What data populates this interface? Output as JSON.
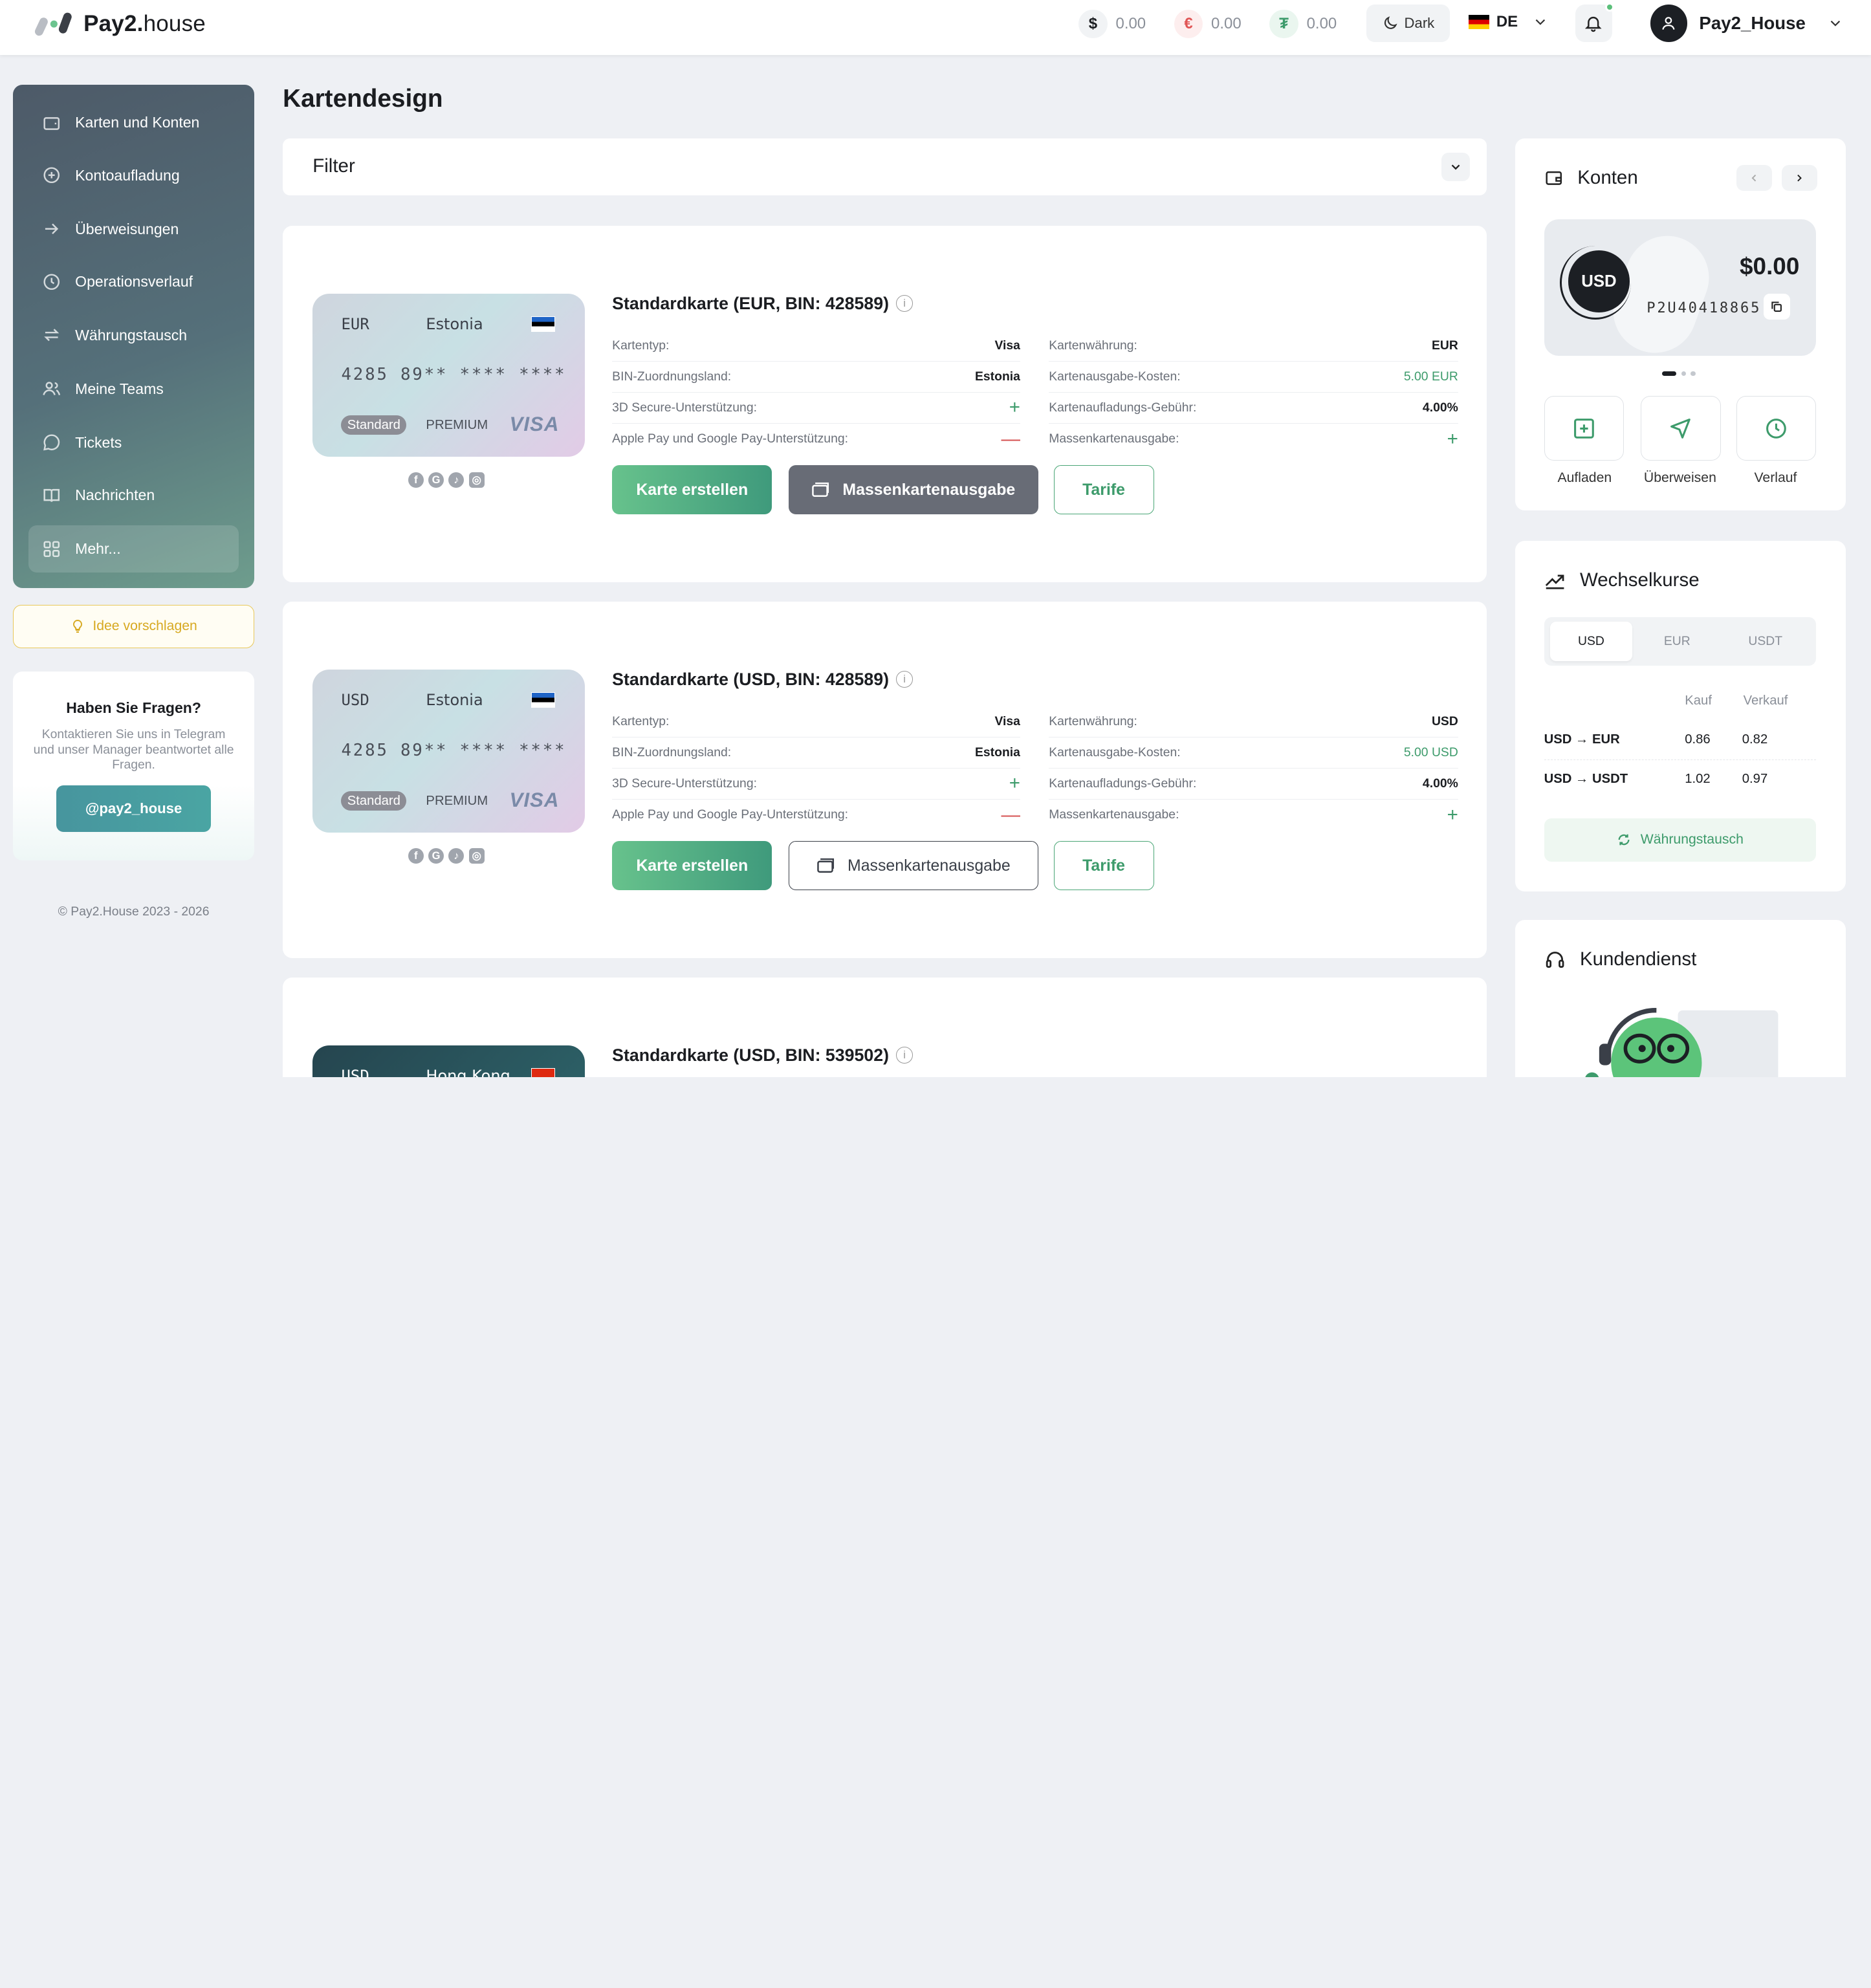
{
  "header": {
    "logo_bold": "Pay2.",
    "logo_light": "house",
    "balances": [
      {
        "symbol": "$",
        "value": "0.00",
        "color": "#1b1d21",
        "bg": "#f1f3f5"
      },
      {
        "symbol": "€",
        "value": "0.00",
        "color": "#e05555",
        "bg": "#fdeeee"
      },
      {
        "symbol": "₮",
        "value": "0.00",
        "color": "#3d9b6b",
        "bg": "#eaf6ef"
      }
    ],
    "theme_label": "Dark",
    "language": "DE",
    "username": "Pay2_House"
  },
  "sidebar": {
    "items": [
      {
        "label": "Karten und Konten",
        "icon": "wallet-icon"
      },
      {
        "label": "Kontoaufladung",
        "icon": "plus-circle-icon"
      },
      {
        "label": "Überweisungen",
        "icon": "arrow-right-icon"
      },
      {
        "label": "Operationsverlauf",
        "icon": "clock-icon"
      },
      {
        "label": "Währungstausch",
        "icon": "exchange-icon"
      },
      {
        "label": "Meine Teams",
        "icon": "team-icon"
      },
      {
        "label": "Tickets",
        "icon": "chat-icon"
      },
      {
        "label": "Nachrichten",
        "icon": "book-icon"
      },
      {
        "label": "Mehr...",
        "icon": "grid-icon"
      }
    ],
    "idea_label": "Idee vorschlagen",
    "help_title": "Haben Sie Fragen?",
    "help_text": "Kontaktieren Sie uns in Telegram und unser Manager beantwortet alle Fragen.",
    "telegram_button": "@pay2_house",
    "copyright": "© Pay2.House 2023 - 2026"
  },
  "main": {
    "page_title": "Kartendesign",
    "filter_label": "Filter",
    "cards": [
      {
        "title": "Standardkarte (EUR, BIN: 428589)",
        "card_currency": "EUR",
        "card_country": "Estonia",
        "card_number": "4285 89** **** ****",
        "badge": "Standard",
        "tier": "PREMIUM",
        "network": "VISA",
        "left": [
          {
            "k": "Kartentyp:",
            "v": "Visa",
            "kind": "text"
          },
          {
            "k": "BIN-Zuordnungsland:",
            "v": "Estonia",
            "kind": "text"
          },
          {
            "k": "3D Secure-Unterstützung:",
            "v": "+",
            "kind": "plus"
          },
          {
            "k": "Apple Pay und Google Pay-Unterstützung:",
            "v": "—",
            "kind": "minus"
          }
        ],
        "right": [
          {
            "k": "Kartenwährung:",
            "v": "EUR",
            "kind": "text"
          },
          {
            "k": "Kartenausgabe-Kosten:",
            "v": "5.00 EUR",
            "kind": "green"
          },
          {
            "k": "Kartenaufladungs-Gebühr:",
            "v": "4.00%",
            "kind": "text"
          },
          {
            "k": "Massenkartenausgabe:",
            "v": "+",
            "kind": "plus"
          }
        ],
        "btn_create": "Karte erstellen",
        "btn_mass": "Massenkartenausgabe",
        "btn_tariff": "Tarife",
        "mass_style": "gray"
      },
      {
        "title": "Standardkarte (USD, BIN: 428589)",
        "card_currency": "USD",
        "card_country": "Estonia",
        "card_number": "4285 89** **** ****",
        "badge": "Standard",
        "tier": "PREMIUM",
        "network": "VISA",
        "left": [
          {
            "k": "Kartentyp:",
            "v": "Visa",
            "kind": "text"
          },
          {
            "k": "BIN-Zuordnungsland:",
            "v": "Estonia",
            "kind": "text"
          },
          {
            "k": "3D Secure-Unterstützung:",
            "v": "+",
            "kind": "plus"
          },
          {
            "k": "Apple Pay und Google Pay-Unterstützung:",
            "v": "—",
            "kind": "minus"
          }
        ],
        "right": [
          {
            "k": "Kartenwährung:",
            "v": "USD",
            "kind": "text"
          },
          {
            "k": "Kartenausgabe-Kosten:",
            "v": "5.00 USD",
            "kind": "green"
          },
          {
            "k": "Kartenaufladungs-Gebühr:",
            "v": "4.00%",
            "kind": "text"
          },
          {
            "k": "Massenkartenausgabe:",
            "v": "+",
            "kind": "plus"
          }
        ],
        "btn_create": "Karte erstellen",
        "btn_mass": "Massenkartenausgabe",
        "btn_tariff": "Tarife",
        "mass_style": "outline"
      },
      {
        "title": "Standardkarte (USD, BIN: 539502)",
        "card_currency": "USD",
        "card_country": "Hong Kong"
      }
    ]
  },
  "accounts": {
    "title": "Konten",
    "currency": "USD",
    "amount": "$0.00",
    "number": "P2U40418865",
    "actions": [
      "Aufladen",
      "Überweisen",
      "Verlauf"
    ]
  },
  "rates": {
    "title": "Wechselkurse",
    "tabs": [
      "USD",
      "EUR",
      "USDT"
    ],
    "active_tab": "USD",
    "col_buy": "Kauf",
    "col_sell": "Verkauf",
    "rows": [
      {
        "pair": "USD → EUR",
        "buy": "0.86",
        "sell": "0.82"
      },
      {
        "pair": "USD → USDT",
        "buy": "1.02",
        "sell": "0.97"
      }
    ],
    "exchange_button": "Währungstausch"
  },
  "support": {
    "title": "Kundendienst"
  }
}
